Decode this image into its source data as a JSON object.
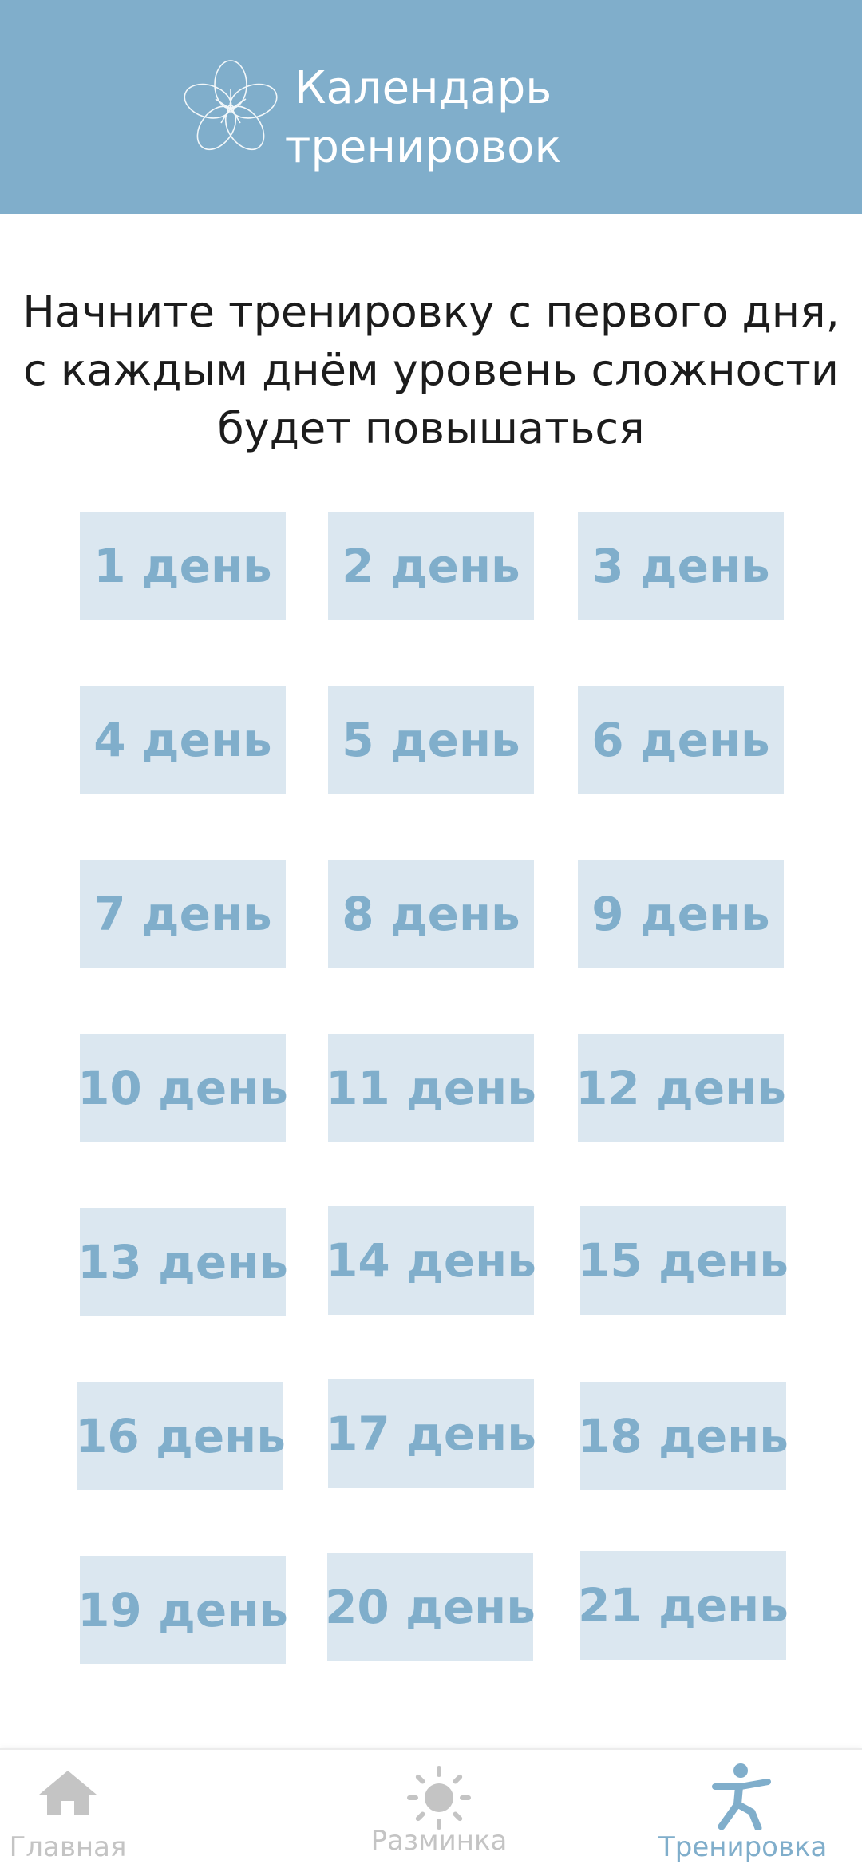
{
  "header": {
    "title_line1": "Календарь",
    "title_line2": "тренировок",
    "logo_icon": "flower-icon",
    "background_color": "#80aecb"
  },
  "intro": {
    "line1": "Начните тренировку с первого дня,",
    "line2": "с каждым днём уровень сложности",
    "line3": "будет повышаться"
  },
  "days": [
    {
      "label": "1 день"
    },
    {
      "label": "2 день"
    },
    {
      "label": "3 день"
    },
    {
      "label": "4 день"
    },
    {
      "label": "5 день"
    },
    {
      "label": "6 день"
    },
    {
      "label": "7 день"
    },
    {
      "label": "8 день"
    },
    {
      "label": "9 день"
    },
    {
      "label": "10 день"
    },
    {
      "label": "11 день"
    },
    {
      "label": "12 день"
    },
    {
      "label": "13 день"
    },
    {
      "label": "14 день"
    },
    {
      "label": "15 день"
    },
    {
      "label": "16 день"
    },
    {
      "label": "17 день"
    },
    {
      "label": "18 день"
    },
    {
      "label": "19 день"
    },
    {
      "label": "20 день"
    },
    {
      "label": "21 день"
    }
  ],
  "colors": {
    "accent": "#80aecb",
    "button_background": "#dbe7f0",
    "inactive": "#c4c4c4"
  },
  "bottom_nav": {
    "items": [
      {
        "label": "Главная",
        "icon": "home-icon",
        "active": false
      },
      {
        "label": "Разминка",
        "icon": "sun-icon",
        "active": false
      },
      {
        "label": "Тренировка",
        "icon": "yoga-figure-icon",
        "active": true
      }
    ]
  }
}
